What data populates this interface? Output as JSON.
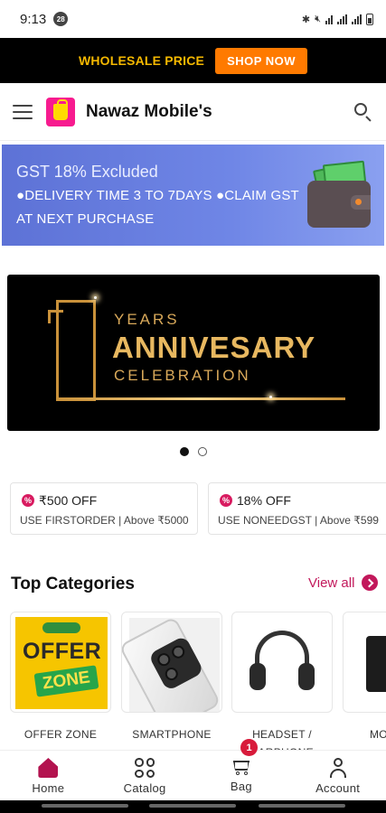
{
  "status_bar": {
    "time": "9:13",
    "notif_count": "28"
  },
  "promo": {
    "text": "WHOLESALE PRICE",
    "button": "SHOP NOW"
  },
  "header": {
    "brand": "Nawaz Mobile's"
  },
  "gst_banner": {
    "title": "GST 18% Excluded",
    "line1": "●DELIVERY TIME 3 TO 7DAYS ●CLAIM GST",
    "line2": "AT NEXT PURCHASE"
  },
  "anniversary": {
    "number": "1",
    "years": "YEARS",
    "main": "ANNIVESARY",
    "sub": "CELEBRATION"
  },
  "carousel": {
    "count": 2,
    "active": 0
  },
  "coupons": [
    {
      "title": "₹500 OFF",
      "sub": "USE FIRSTORDER | Above ₹5000"
    },
    {
      "title": "18% OFF",
      "sub": "USE NONEEDGST | Above ₹599"
    }
  ],
  "categories_section": {
    "title": "Top Categories",
    "view_all": "View all"
  },
  "categories": [
    {
      "label": "OFFER ZONE",
      "image_text_1": "OFFER",
      "image_text_2": "ZONE"
    },
    {
      "label": "SMARTPHONE"
    },
    {
      "label": "HEADSET / EARPHONE"
    },
    {
      "label": "MO CHAR"
    }
  ],
  "bottom_nav": {
    "items": [
      {
        "label": "Home",
        "icon": "home-icon"
      },
      {
        "label": "Catalog",
        "icon": "grid-icon"
      },
      {
        "label": "Bag",
        "icon": "cart-icon"
      },
      {
        "label": "Account",
        "icon": "user-icon"
      }
    ],
    "bag_count": "1"
  },
  "colors": {
    "accent": "#c2185b",
    "promo_text": "#f5b800",
    "shop_button": "#ff7a00",
    "banner": "#6f86e6"
  }
}
